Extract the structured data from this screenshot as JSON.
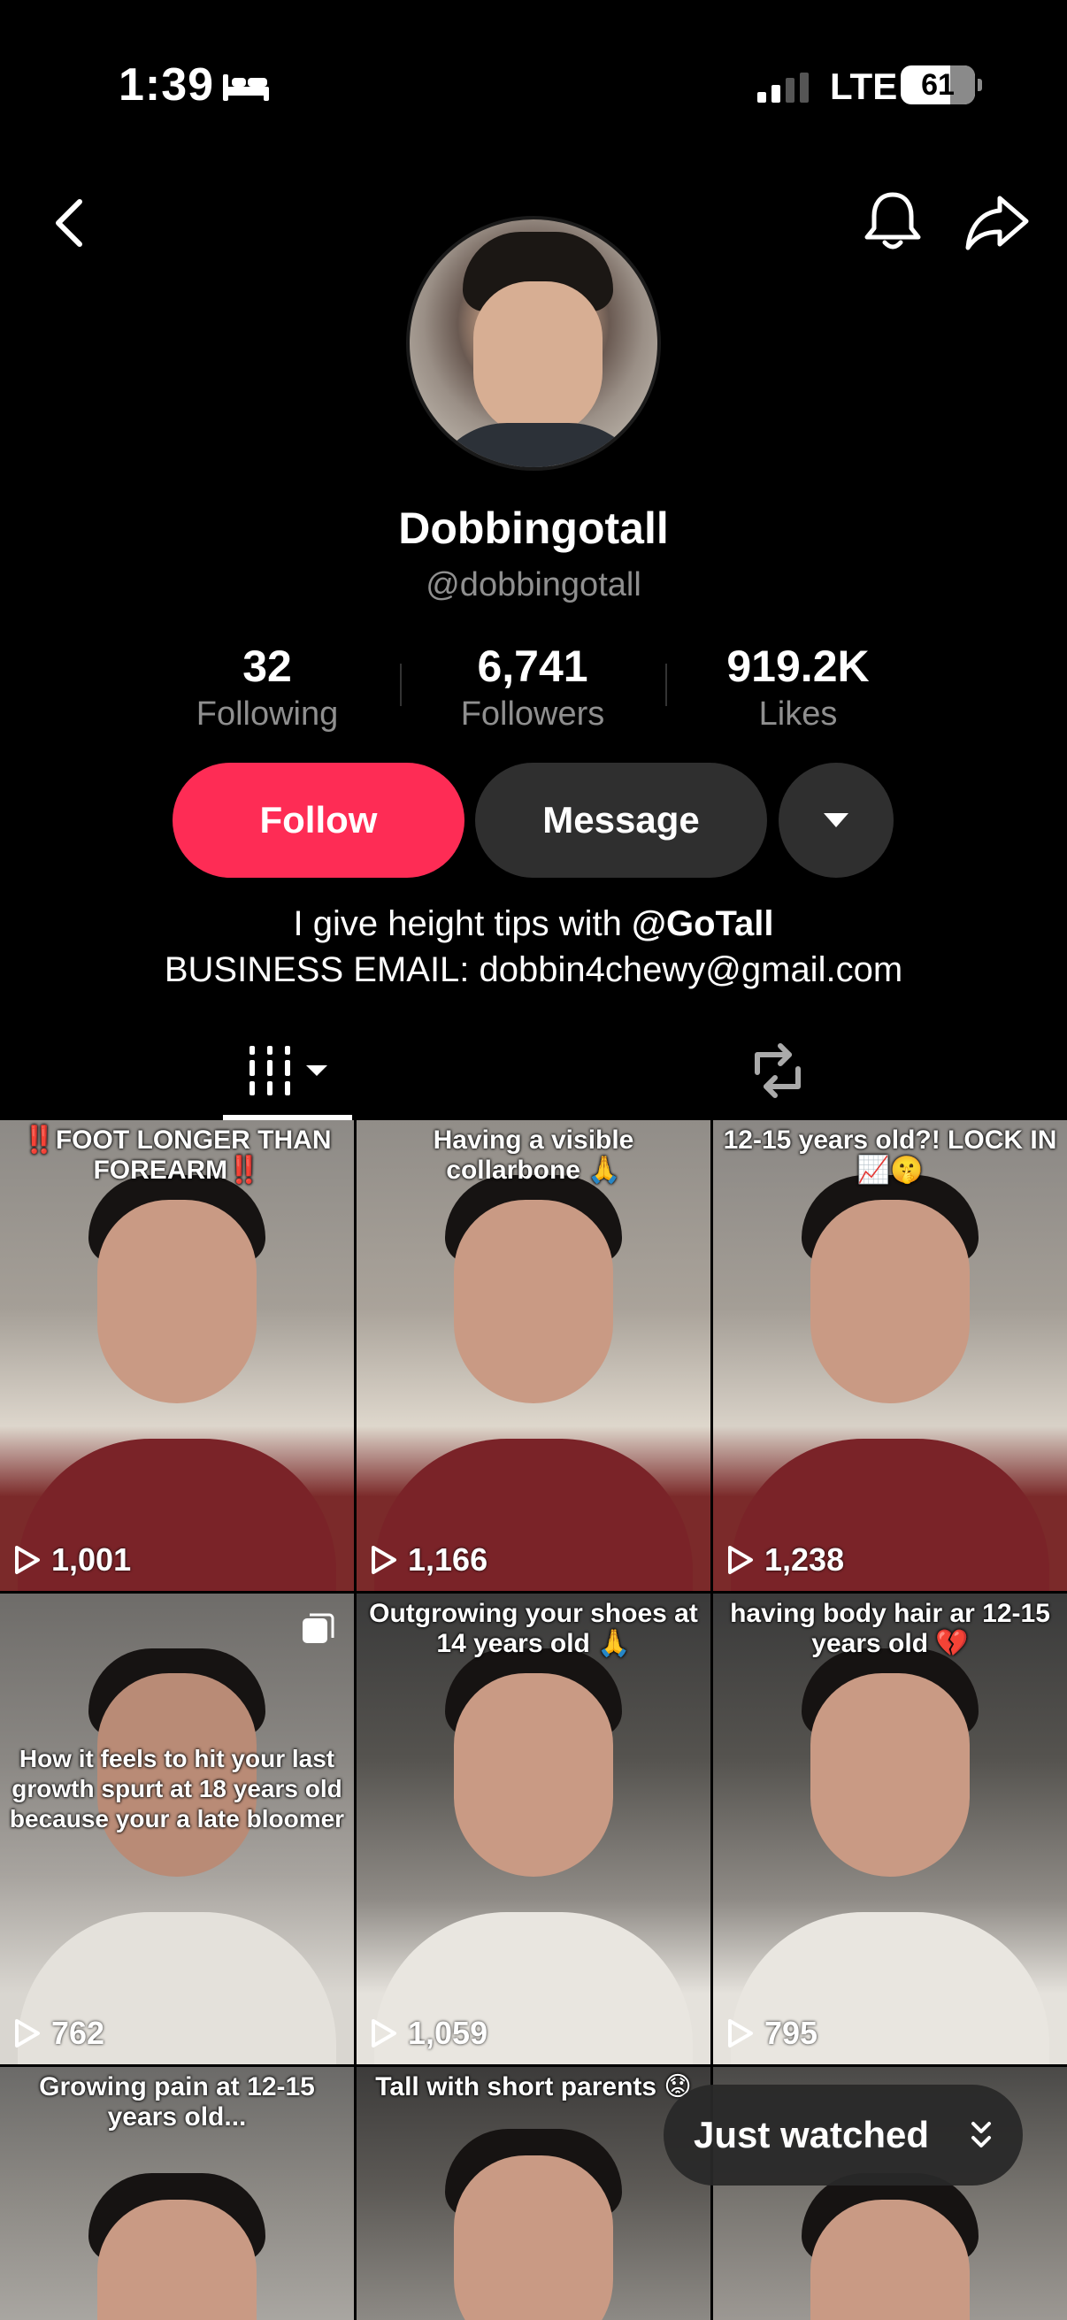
{
  "status_bar": {
    "time": "1:39",
    "network": "LTE",
    "battery": "61"
  },
  "profile": {
    "display_name": "Dobbingotall",
    "username": "@dobbingotall",
    "stats": [
      {
        "value": "32",
        "label": "Following"
      },
      {
        "value": "6,741",
        "label": "Followers"
      },
      {
        "value": "919.2K",
        "label": "Likes"
      }
    ],
    "buttons": {
      "follow": "Follow",
      "message": "Message"
    },
    "bio_line1_prefix": "I give height tips with ",
    "bio_line1_mention": "@GoTall",
    "bio_line2": "BUSINESS EMAIL: dobbin4chewy@gmail.com"
  },
  "videos": [
    {
      "caption": "‼️FOOT LONGER THAN FOREARM‼️",
      "views": "1,001"
    },
    {
      "caption": "Having a visible collarbone 🙏",
      "views": "1,166"
    },
    {
      "caption": "12-15 years old?! LOCK IN 📈🤫",
      "views": "1,238"
    },
    {
      "caption": "How it feels to hit your last growth spurt at 18 years old because your a late bloomer",
      "views": "762"
    },
    {
      "caption": "Outgrowing your shoes at 14 years old 🙏",
      "views": "1,059"
    },
    {
      "caption": "having body hair ar 12-15 years old 💔",
      "views": "795"
    },
    {
      "caption": "Growing pain at 12-15 years old...",
      "views": ""
    },
    {
      "caption": "Tall with short parents 😟",
      "views": ""
    },
    {
      "caption": "",
      "views": ""
    }
  ],
  "just_watched": "Just watched",
  "colors": {
    "follow": "#fe2c55",
    "button_dark": "#2f2f2f",
    "muted_text": "#8f8f8f"
  }
}
